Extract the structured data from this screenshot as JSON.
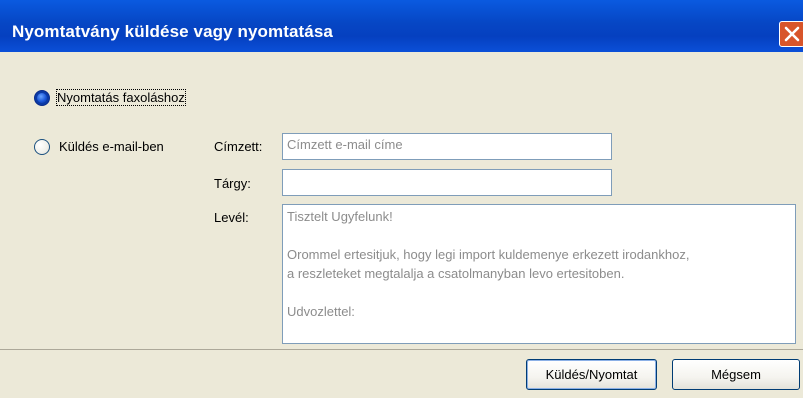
{
  "window": {
    "title": "Nyomtatvány küldése vagy nyomtatása",
    "close_icon": "close-icon"
  },
  "options": {
    "fax_label": "Nyomtatás faxoláshoz",
    "email_label": "Küldés e-mail-ben",
    "selected": "fax"
  },
  "form": {
    "recipient_label": "Címzett:",
    "recipient_placeholder": "Címzett e-mail címe",
    "recipient_value": "",
    "subject_label": "Tárgy:",
    "subject_value": "",
    "message_label": "Levél:",
    "message_value": "Tisztelt Ugyfelunk!\n\nOrommel ertesitjuk, hogy legi import kuldemenye erkezett irodankhoz,\na reszleteket megtalalja a csatolmanyban levo ertesitoben.\n\nUdvozlettel:"
  },
  "buttons": {
    "send_print": "Küldés/Nyomtat",
    "cancel": "Mégsem"
  }
}
